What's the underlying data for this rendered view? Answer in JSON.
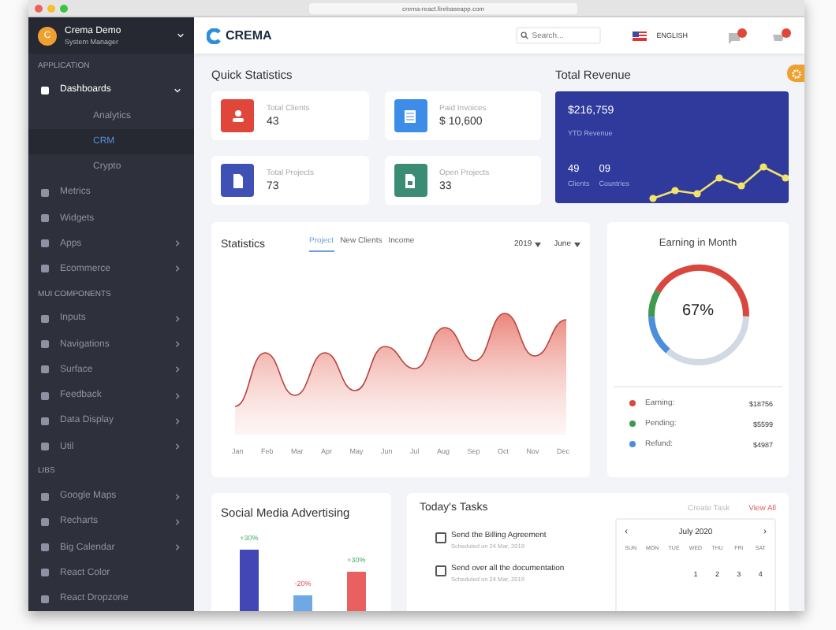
{
  "browser": {
    "url": "crema-react.firebaseapp.com"
  },
  "sidebar": {
    "profile": {
      "initial": "C",
      "name": "Crema Demo",
      "role": "System Manager"
    },
    "items": [
      {
        "kind": "header",
        "label": "APPLICATION"
      },
      {
        "kind": "item",
        "label": "Dashboards",
        "expanded": true,
        "children": [
          {
            "label": "Analytics",
            "selected": false
          },
          {
            "label": "CRM",
            "selected": true
          },
          {
            "label": "Crypto",
            "selected": false
          }
        ]
      },
      {
        "kind": "item",
        "label": "Metrics"
      },
      {
        "kind": "item",
        "label": "Widgets"
      },
      {
        "kind": "item",
        "label": "Apps",
        "expanded": false
      },
      {
        "kind": "item",
        "label": "Ecommerce",
        "expanded": false
      },
      {
        "kind": "header",
        "label": "MUI COMPONENTS"
      },
      {
        "kind": "item",
        "label": "Inputs",
        "expanded": false
      },
      {
        "kind": "item",
        "label": "Navigations",
        "expanded": false
      },
      {
        "kind": "item",
        "label": "Surface",
        "expanded": false
      },
      {
        "kind": "item",
        "label": "Feedback",
        "expanded": false
      },
      {
        "kind": "item",
        "label": "Data Display",
        "expanded": false
      },
      {
        "kind": "item",
        "label": "Util",
        "expanded": false
      },
      {
        "kind": "header",
        "label": "LIBS"
      },
      {
        "kind": "item",
        "label": "Google Maps",
        "expanded": false
      },
      {
        "kind": "item",
        "label": "Recharts",
        "expanded": false
      },
      {
        "kind": "item",
        "label": "Big Calendar",
        "expanded": false
      },
      {
        "kind": "item",
        "label": "React Color"
      },
      {
        "kind": "item",
        "label": "React Dropzone"
      }
    ]
  },
  "topbar": {
    "logo": "CREMA",
    "search": {
      "placeholder": "Search..."
    },
    "language": "ENGLISH",
    "icons": [
      {
        "kind": "message"
      },
      {
        "kind": "cart"
      }
    ]
  },
  "quick_stats": {
    "title": "Quick Statistics",
    "cards": [
      {
        "label": "Total Clients",
        "value": "43",
        "color": "#e0463a"
      },
      {
        "label": "Paid Invoices",
        "value": "$ 10,600",
        "color": "#3d8ce8"
      },
      {
        "label": "Total Projects",
        "value": "73",
        "color": "#3f51b5"
      },
      {
        "label": "Open Projects",
        "value": "33",
        "color": "#3a8c74"
      }
    ]
  },
  "revenue": {
    "title": "Total Revenue",
    "amount": "$216,759",
    "caption": "YTD Revenue",
    "stats": [
      {
        "value": "49",
        "label": "Clients"
      },
      {
        "value": "09",
        "label": "Countries"
      }
    ]
  },
  "statistics": {
    "title": "Statistics",
    "tabs": [
      {
        "label": "Project",
        "selected": true
      },
      {
        "label": "New Clients",
        "selected": false
      },
      {
        "label": "Income",
        "selected": false
      }
    ],
    "filters": [
      "2019",
      "June"
    ],
    "months": [
      "Jan",
      "Feb",
      "Mar",
      "Apr",
      "May",
      "Jun",
      "Jul",
      "Aug",
      "Sep",
      "Oct",
      "Nov",
      "Dec"
    ]
  },
  "earning": {
    "title": "Earning in Month",
    "percent": "67%",
    "items": [
      {
        "label": "Earning:",
        "value": "$18756",
        "color": "#d9473f"
      },
      {
        "label": "Pending:",
        "value": "$5599",
        "color": "#3f9a4f"
      },
      {
        "label": "Refund:",
        "value": "$4987",
        "color": "#4a8fdc"
      }
    ]
  },
  "social": {
    "title": "Social Media Advertising",
    "bars": [
      {
        "kind": "increase",
        "change": "+30%",
        "color": "#4347b5"
      },
      {
        "kind": "decrease",
        "change": "-20%",
        "color": "#6ea9e6"
      },
      {
        "kind": "increase",
        "change": "+30%",
        "color": "#e86060"
      }
    ]
  },
  "tasks": {
    "title": "Today's Tasks",
    "actions": [
      {
        "kind": "secondary",
        "label": "Create Task"
      },
      {
        "kind": "primary",
        "label": "View All"
      }
    ],
    "items": [
      {
        "title": "Send the Billing Agreement",
        "schedule": "Scheduled on 24 Mar, 2019",
        "checked": false
      },
      {
        "title": "Send over all the documentation",
        "schedule": "Scheduled on 24 Mar, 2019",
        "checked": false
      }
    ],
    "calendar": {
      "prev": "‹",
      "month": "July 2020",
      "next": "›",
      "weekdays": [
        "SUN",
        "MON",
        "TUE",
        "WED",
        "THU",
        "FRI",
        "SAT"
      ],
      "first_week": [
        "1",
        "2",
        "3",
        "4"
      ]
    }
  }
}
